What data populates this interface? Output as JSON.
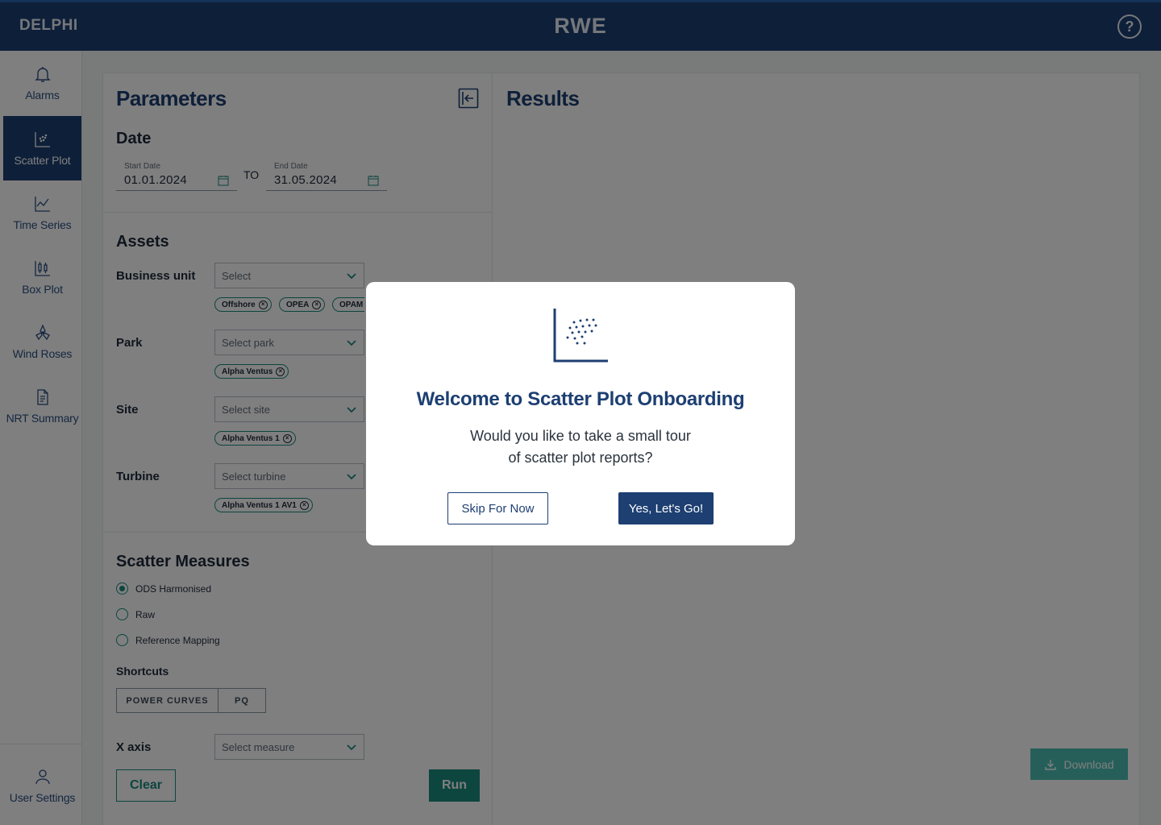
{
  "header": {
    "brand": "DELPHI",
    "logo": "RWE",
    "help": "?"
  },
  "sidebar": {
    "items": [
      {
        "label": "Alarms",
        "icon": "bell-icon"
      },
      {
        "label": "Scatter Plot",
        "icon": "scatter-plot-icon",
        "active": true
      },
      {
        "label": "Time Series",
        "icon": "line-chart-icon"
      },
      {
        "label": "Box Plot",
        "icon": "box-plot-icon"
      },
      {
        "label": "Wind Roses",
        "icon": "wind-rose-icon"
      },
      {
        "label": "NRT Summary",
        "icon": "document-icon"
      }
    ],
    "user": {
      "label": "User Settings",
      "icon": "user-icon"
    }
  },
  "params": {
    "title": "Parameters",
    "date": {
      "section": "Date",
      "start_label": "Start Date",
      "start_value": "01.01.2024",
      "to": "TO",
      "end_label": "End Date",
      "end_value": "31.05.2024"
    },
    "assets": {
      "section": "Assets",
      "business_unit": {
        "label": "Business unit",
        "placeholder": "Select",
        "chips": [
          "Offshore",
          "OPEA",
          "OPAM"
        ]
      },
      "park": {
        "label": "Park",
        "placeholder": "Select park",
        "chips": [
          "Alpha Ventus"
        ]
      },
      "site": {
        "label": "Site",
        "placeholder": "Select site",
        "chips": [
          "Alpha Ventus 1"
        ]
      },
      "turbine": {
        "label": "Turbine",
        "placeholder": "Select turbine",
        "chips": [
          "Alpha Ventus 1 AV1"
        ]
      }
    },
    "scatter": {
      "section": "Scatter Measures",
      "options": [
        "ODS Harmonised",
        "Raw",
        "Reference Mapping"
      ],
      "selected": "ODS Harmonised",
      "shortcuts_label": "Shortcuts",
      "shortcuts": [
        "POWER CURVES",
        "PQ"
      ],
      "x_axis_label": "X axis",
      "x_axis_placeholder": "Select measure"
    },
    "clear_label": "Clear",
    "run_label": "Run"
  },
  "results": {
    "title": "Results",
    "download_label": "Download"
  },
  "modal": {
    "title": "Welcome to Scatter Plot Onboarding",
    "body_line1": "Would you like to take a small tour",
    "body_line2": "of scatter plot reports?",
    "skip_label": "Skip For Now",
    "go_label": "Yes, Let's Go!"
  },
  "colors": {
    "navy": "#1d3f72",
    "teal": "#1a8a7e"
  }
}
